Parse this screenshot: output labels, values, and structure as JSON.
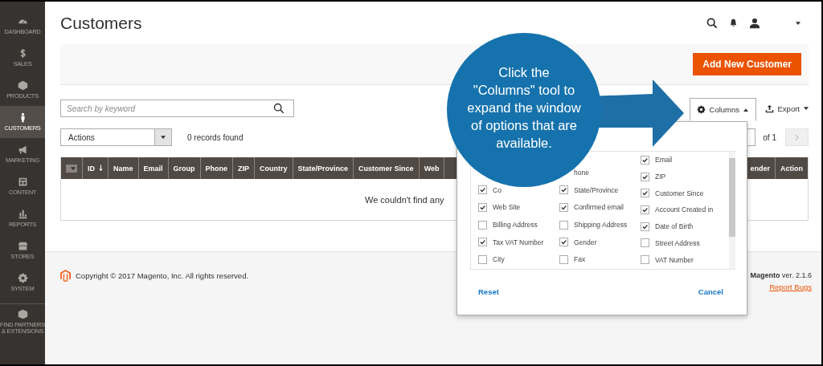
{
  "sidebar": {
    "items": [
      {
        "label": "DASHBOARD",
        "selected": false
      },
      {
        "label": "SALES",
        "selected": false
      },
      {
        "label": "PRODUCTS",
        "selected": false
      },
      {
        "label": "CUSTOMERS",
        "selected": true
      },
      {
        "label": "MARKETING",
        "selected": false
      },
      {
        "label": "CONTENT",
        "selected": false
      },
      {
        "label": "REPORTS",
        "selected": false
      },
      {
        "label": "STORES",
        "selected": false
      },
      {
        "label": "SYSTEM",
        "selected": false
      },
      {
        "label": "FIND PARTNERS & EXTENSIONS",
        "selected": false
      }
    ]
  },
  "header": {
    "title": "Customers"
  },
  "action_bar": {
    "add_button": "Add New Customer"
  },
  "search": {
    "placeholder": "Search by keyword"
  },
  "actions": {
    "label": "Actions"
  },
  "records_found": "0 records found",
  "toolbar": {
    "columns_button": {
      "label": "Columns",
      "expanded": true
    },
    "export_button": "Export"
  },
  "pager": {
    "total": "of 1"
  },
  "table": {
    "columns": [
      "ID",
      "Name",
      "Email",
      "Group",
      "Phone",
      "ZIP",
      "Country",
      "State/Province",
      "Customer Since",
      "Web"
    ],
    "trailing_columns": [
      "ender",
      "Action"
    ],
    "empty_message": "We couldn't find any"
  },
  "columns_panel": {
    "columns": [
      [
        {
          "label": "Co",
          "checked": true
        },
        {
          "label": "Web Site",
          "checked": true
        },
        {
          "label": "Billing Address",
          "checked": false
        },
        {
          "label": "Tax VAT Number",
          "checked": true
        },
        {
          "label": "City",
          "checked": false
        }
      ],
      [
        {
          "label": "hone"
        },
        {
          "label": "State/Province",
          "checked": true
        },
        {
          "label": "Confirmed email",
          "checked": true
        },
        {
          "label": "Shipping Address",
          "checked": false
        },
        {
          "label": "Gender",
          "checked": true
        },
        {
          "label": "Fax",
          "checked": false
        }
      ],
      [
        {
          "label": "Email",
          "checked": true
        },
        {
          "label": "ZIP",
          "checked": true
        },
        {
          "label": "Customer Since",
          "checked": true
        },
        {
          "label": "Account Created in",
          "checked": true
        },
        {
          "label": "Date of Birth",
          "checked": true
        },
        {
          "label": "Street Address",
          "checked": false
        },
        {
          "label": "VAT Number",
          "checked": false
        }
      ]
    ],
    "reset": "Reset",
    "cancel": "Cancel"
  },
  "footer": {
    "copyright": "Copyright © 2017 Magento, Inc. All rights reserved.",
    "version": "**Magento** ver. 2.1.6",
    "report_bugs": "Report Bugs"
  },
  "callout": {
    "lines": [
      "Click the",
      "\"Columns\" tool to",
      "expand the window",
      "of options that are",
      "available."
    ]
  }
}
